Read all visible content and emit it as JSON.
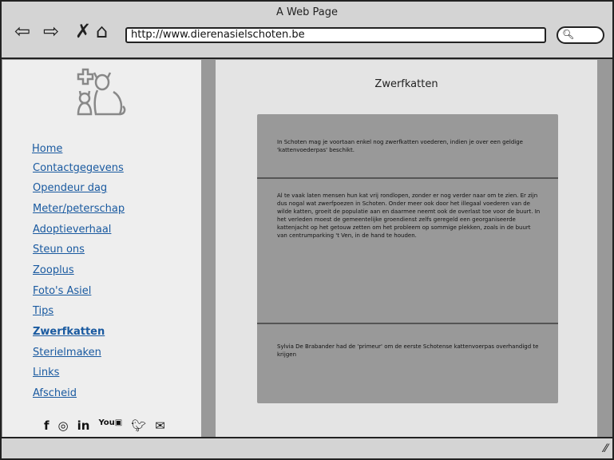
{
  "browser": {
    "title": "A Web Page",
    "url": "http://www.dierenasielschoten.be"
  },
  "sidebar": {
    "items": [
      {
        "label": "Home"
      },
      {
        "label": "Contactgegevens"
      },
      {
        "label": "Opendeur dag"
      },
      {
        "label": "Meter/peterschap"
      },
      {
        "label": "Adoptieverhaal"
      },
      {
        "label": "Steun ons"
      },
      {
        "label": "Zooplus"
      },
      {
        "label": "Foto's Asiel"
      },
      {
        "label": "Tips"
      },
      {
        "label": "Zwerfkatten"
      },
      {
        "label": "Sterielmaken"
      },
      {
        "label": "Links"
      },
      {
        "label": "Afscheid"
      }
    ],
    "social": [
      "facebook-icon",
      "instagram-icon",
      "linkedin-icon",
      "youtube-icon",
      "twitter-icon",
      "mail-icon"
    ]
  },
  "main": {
    "heading": "Zwerfkatten",
    "paragraphs": [
      "In Schoten mag je voortaan enkel nog zwerfkatten voederen, indien je over een geldige 'kattenvoederpas' beschikt.",
      "Al te vaak laten mensen hun kat vrij rondlopen, zonder er nog verder naar om te zien. Er zijn dus nogal wat zwerfpoezen in Schoten. Onder meer ook door het illegaal voederen van de wilde katten, groeit de populatie aan en daarmee neemt ook de overlast toe voor de buurt. In het verleden moest de gemeentelijke groendienst zelfs geregeld een georganiseerde kattenjacht op het getouw zetten om het probleem op sommige plekken, zoals in de buurt van centrumparking 't Ven, in de hand te houden.",
      "Sylvia De Brabander had de 'primeur' om de eerste Schotense kattenvoerpas overhandigd te krijgen"
    ]
  }
}
